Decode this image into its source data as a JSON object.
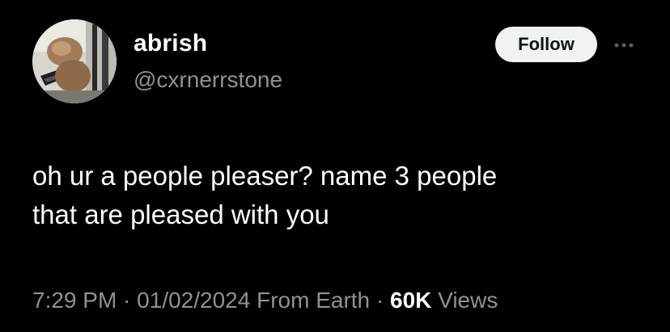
{
  "user": {
    "display_name": "abrish",
    "handle": "@cxrnerrstone",
    "avatar_icon": "avatar-photo-cat"
  },
  "actions": {
    "follow_label": "Follow",
    "more_icon": "more-dots-icon"
  },
  "tweet": {
    "lines": [
      "oh ur a people pleaser? name 3 people",
      "that are pleased with you"
    ]
  },
  "meta": {
    "time": "7:29 PM",
    "separator": " · ",
    "date": "01/02/2024",
    "source": " From Earth",
    "views_count": "60K",
    "views_label": " Views"
  },
  "colors": {
    "background": "#000000",
    "primary_text": "#ffffff",
    "secondary_text": "#8b9299",
    "follow_button_bg": "#eff3f4",
    "follow_button_text": "#0f1419"
  }
}
